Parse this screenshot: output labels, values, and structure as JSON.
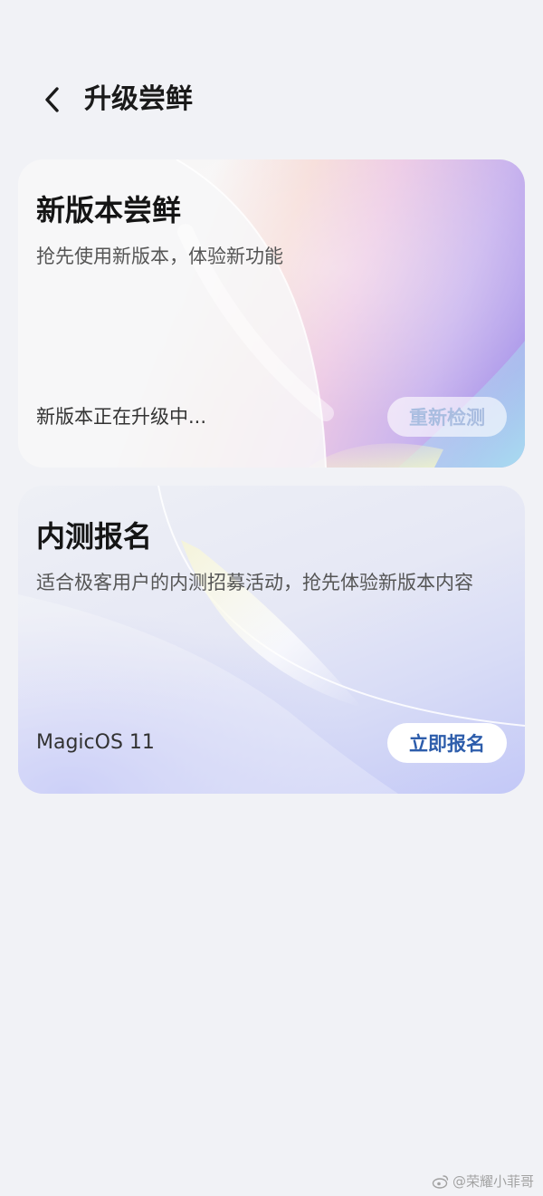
{
  "header": {
    "title": "升级尝鲜"
  },
  "cards": [
    {
      "title": "新版本尝鲜",
      "description": "抢先使用新版本，体验新功能",
      "status": "新版本正在升级中...",
      "button_label": "重新检测"
    },
    {
      "title": "内测报名",
      "description": "适合极客用户的内测招募活动，抢先体验新版本内容",
      "version": "MagicOS 11",
      "button_label": "立即报名"
    }
  ],
  "watermark": {
    "text": "@荣耀小菲哥"
  },
  "colors": {
    "background": "#f1f2f6",
    "accent_button_text": "#2d5dab",
    "disabled_button_text": "#a9bde0"
  }
}
